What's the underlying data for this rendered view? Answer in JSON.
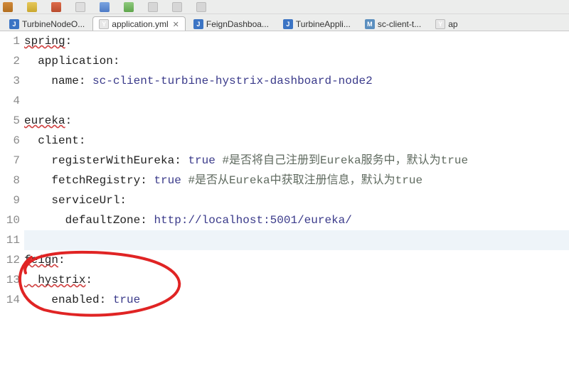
{
  "toolbar": {
    "icons": [
      "new",
      "save",
      "saveall",
      "undo",
      "redo",
      "run",
      "debug",
      "cfg",
      "ext"
    ]
  },
  "tabs": [
    {
      "kind": "J",
      "label": "TurbineNodeO...",
      "active": false
    },
    {
      "kind": "Y",
      "label": "application.yml",
      "active": true,
      "close": "✕"
    },
    {
      "kind": "J",
      "label": "FeignDashboa...",
      "active": false
    },
    {
      "kind": "J",
      "label": "TurbineAppli...",
      "active": false
    },
    {
      "kind": "M",
      "label": "sc-client-t...",
      "active": false
    },
    {
      "kind": "Y",
      "label": "ap",
      "active": false
    }
  ],
  "code": {
    "lines": [
      {
        "n": 1,
        "seg": [
          {
            "t": "spring",
            "c": "key",
            "sq": true
          },
          {
            "t": ":",
            "c": "colon"
          }
        ]
      },
      {
        "n": 2,
        "seg": [
          {
            "t": "  application",
            "c": "key"
          },
          {
            "t": ":",
            "c": "colon"
          }
        ]
      },
      {
        "n": 3,
        "seg": [
          {
            "t": "    name",
            "c": "key"
          },
          {
            "t": ": ",
            "c": "colon"
          },
          {
            "t": "sc-client-turbine-hystrix-dashboard-node2",
            "c": "str"
          }
        ]
      },
      {
        "n": 4,
        "seg": []
      },
      {
        "n": 5,
        "seg": [
          {
            "t": "eureka",
            "c": "key",
            "sq": true
          },
          {
            "t": ":",
            "c": "colon"
          }
        ]
      },
      {
        "n": 6,
        "seg": [
          {
            "t": "  client",
            "c": "key"
          },
          {
            "t": ":",
            "c": "colon"
          }
        ]
      },
      {
        "n": 7,
        "seg": [
          {
            "t": "    registerWithEureka",
            "c": "key"
          },
          {
            "t": ": ",
            "c": "colon"
          },
          {
            "t": "true",
            "c": "bool"
          },
          {
            "t": " #是否将自己注册到Eureka服务中，默认为true",
            "c": "comment"
          }
        ]
      },
      {
        "n": 8,
        "seg": [
          {
            "t": "    fetchRegistry",
            "c": "key"
          },
          {
            "t": ": ",
            "c": "colon"
          },
          {
            "t": "true",
            "c": "bool"
          },
          {
            "t": " #是否从Eureka中获取注册信息，默认为true",
            "c": "comment"
          }
        ]
      },
      {
        "n": 9,
        "seg": [
          {
            "t": "    serviceUrl",
            "c": "key"
          },
          {
            "t": ":",
            "c": "colon"
          }
        ]
      },
      {
        "n": 10,
        "seg": [
          {
            "t": "      defaultZone",
            "c": "key"
          },
          {
            "t": ": ",
            "c": "colon"
          },
          {
            "t": "http://localhost:5001/eureka/",
            "c": "str"
          }
        ]
      },
      {
        "n": 11,
        "seg": [],
        "cursor": true
      },
      {
        "n": 12,
        "seg": [
          {
            "t": "feign",
            "c": "key",
            "sq": true
          },
          {
            "t": ":",
            "c": "colon"
          }
        ]
      },
      {
        "n": 13,
        "seg": [
          {
            "t": "  hystrix",
            "c": "key",
            "sq": true
          },
          {
            "t": ":",
            "c": "colon"
          }
        ]
      },
      {
        "n": 14,
        "seg": [
          {
            "t": "    enabled",
            "c": "key"
          },
          {
            "t": ": ",
            "c": "colon"
          },
          {
            "t": "true",
            "c": "bool"
          }
        ]
      }
    ]
  },
  "annotation": {
    "label": "freehand-circle",
    "color": "#e02424"
  }
}
